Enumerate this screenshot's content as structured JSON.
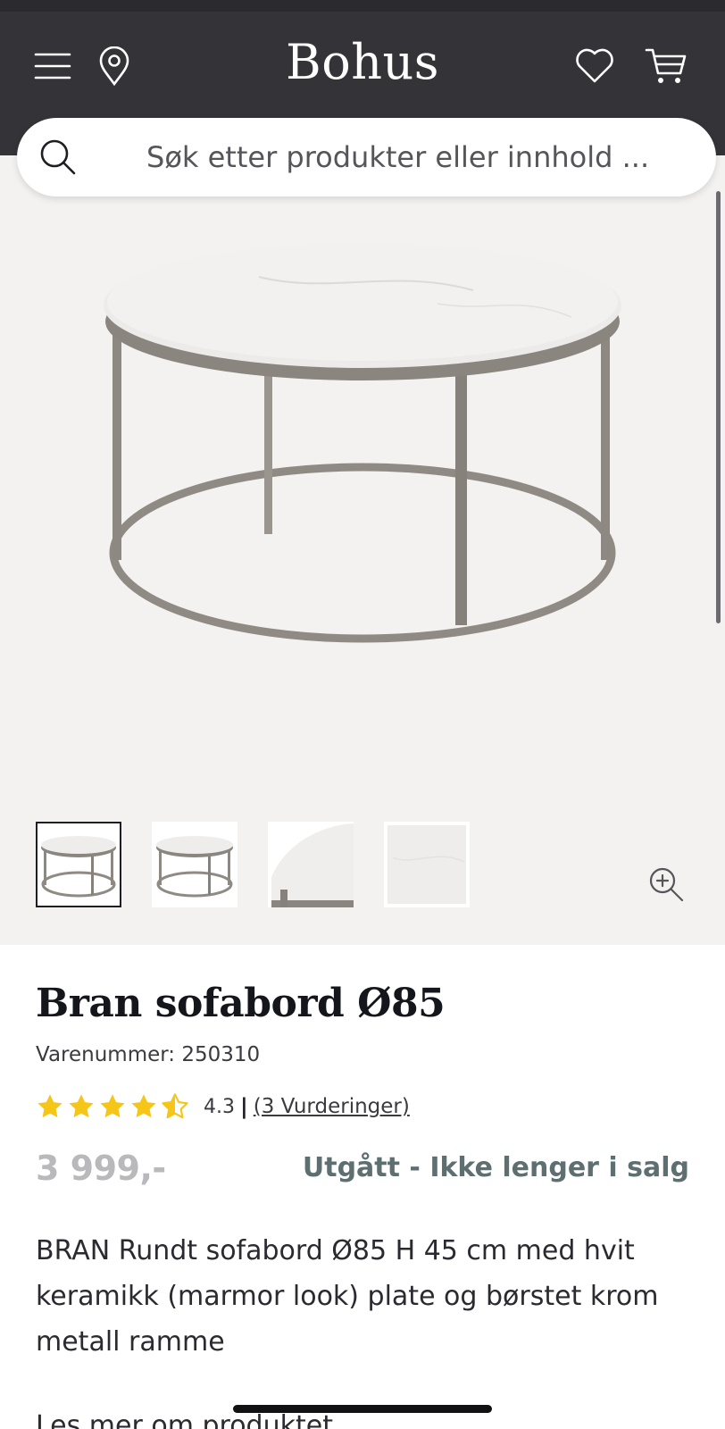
{
  "header": {
    "logo": "Bohus",
    "icons": [
      "menu-icon",
      "location-pin-icon",
      "heart-icon",
      "cart-icon"
    ],
    "background": "#333338"
  },
  "search": {
    "placeholder": "Søk etter produkter eller innhold ..."
  },
  "gallery": {
    "thumbnail_count": 4,
    "active_thumbnail": 1,
    "background": "#f4f2f0"
  },
  "product": {
    "title": "Bran sofabord Ø85",
    "sku_label": "Varenummer: 250310",
    "rating_value": "4.3",
    "rating_stars": 4.3,
    "rating_separator": "|",
    "rating_count_label": "(3 Vurderinger)",
    "price": "3 999,-",
    "status": "Utgått - Ikke lenger i salg",
    "description": "BRAN Rundt sofabord Ø85 H 45 cm med hvit keramikk (marmor look) plate og børstet krom metall ramme",
    "next_heading": "Les mer om produktet"
  },
  "colors": {
    "star": "#f5c518",
    "status_text": "#5e6f71",
    "price_text": "#b9b9bc"
  }
}
